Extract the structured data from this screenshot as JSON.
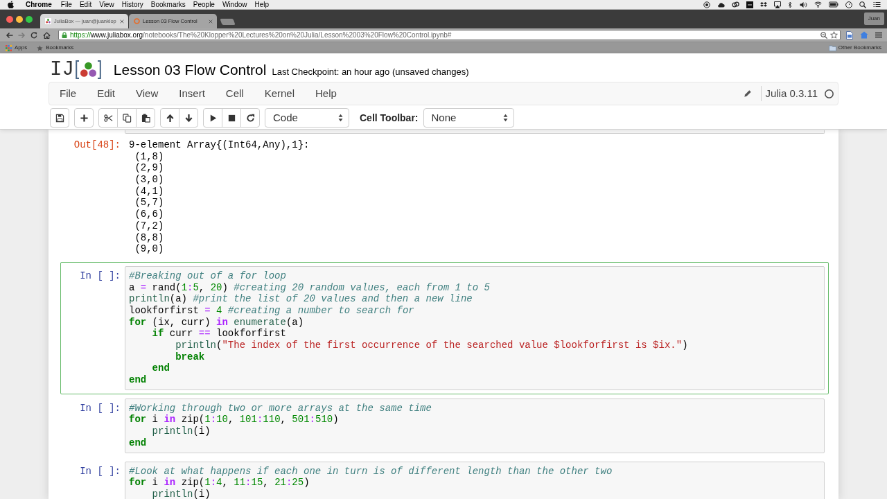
{
  "mac_menu_bar": {
    "app": "Chrome",
    "menus": [
      "File",
      "Edit",
      "View",
      "History",
      "Bookmarks",
      "People",
      "Window",
      "Help"
    ]
  },
  "browser": {
    "tabs": [
      {
        "title": "JuliaBox — juan@juanklop",
        "selected": false
      },
      {
        "title": "Lesson 03 Flow Control",
        "selected": true
      }
    ],
    "profile": "Juan",
    "address": {
      "scheme": "https://",
      "host": "www.juliabox.org",
      "path": "/notebooks/The%20Klopper%20Lectures%20on%20Julia/Lesson%2003%20Flow%20Control.ipynb#"
    },
    "bookmarks": [
      "Apps",
      "Bookmarks"
    ],
    "other_bookmarks": "Other Bookmarks"
  },
  "notebook": {
    "logo": "IJ",
    "title": "Lesson 03 Flow Control",
    "checkpoint": "Last Checkpoint: an hour ago (unsaved changes)",
    "menus": [
      "File",
      "Edit",
      "View",
      "Insert",
      "Cell",
      "Kernel",
      "Help"
    ],
    "kernel": "Julia 0.3.11",
    "cell_type": "Code",
    "cell_toolbar_label": "Cell Toolbar:",
    "cell_toolbar": "None"
  },
  "cells": [
    {
      "kind": "output",
      "prompt": "Out[48]:",
      "selected": false,
      "lines": [
        "9-element Array{(Int64,Any),1}:",
        " (1,8)",
        " (2,9)",
        " (3,0)",
        " (4,1)",
        " (5,7)",
        " (6,6)",
        " (7,2)",
        " (8,8)",
        " (9,0)"
      ]
    },
    {
      "kind": "code",
      "prompt": "In [ ]:",
      "selected": true,
      "lines": [
        [
          {
            "kind": "comment",
            "text": "#Breaking out of a for loop"
          }
        ],
        [
          {
            "kind": "text",
            "text": "a "
          },
          {
            "kind": "operator",
            "text": "="
          },
          {
            "kind": "text",
            "text": " rand("
          },
          {
            "kind": "number",
            "text": "1"
          },
          {
            "kind": "operator",
            "text": ":"
          },
          {
            "kind": "number",
            "text": "5"
          },
          {
            "kind": "text",
            "text": ", "
          },
          {
            "kind": "number",
            "text": "20"
          },
          {
            "kind": "text",
            "text": ") "
          },
          {
            "kind": "comment",
            "text": "#creating 20 random values, each from 1 to 5"
          }
        ],
        [
          {
            "kind": "builtin",
            "text": "println"
          },
          {
            "kind": "text",
            "text": "(a) "
          },
          {
            "kind": "comment",
            "text": "#print the list of 20 values and then a new line"
          }
        ],
        [
          {
            "kind": "text",
            "text": "lookforfirst "
          },
          {
            "kind": "operator",
            "text": "="
          },
          {
            "kind": "number",
            "text": " 4"
          },
          {
            "kind": "comment",
            "text": " #creating a number to search for"
          }
        ],
        [
          {
            "kind": "keyword",
            "text": "for"
          },
          {
            "kind": "text",
            "text": " (ix, curr) "
          },
          {
            "kind": "word_operator",
            "text": "in"
          },
          {
            "kind": "builtin",
            "text": " enumerate"
          },
          {
            "kind": "text",
            "text": "(a)"
          }
        ],
        [
          {
            "kind": "keyword",
            "text": "    if"
          },
          {
            "kind": "text",
            "text": " curr "
          },
          {
            "kind": "operator",
            "text": "=="
          },
          {
            "kind": "text",
            "text": " lookforfirst"
          }
        ],
        [
          {
            "kind": "builtin",
            "text": "        println"
          },
          {
            "kind": "text",
            "text": "("
          },
          {
            "kind": "string",
            "text": "\"The index of the first occurrence of the searched value $lookforfirst is $ix.\""
          },
          {
            "kind": "text",
            "text": ")"
          }
        ],
        [
          {
            "kind": "keyword",
            "text": "        break"
          }
        ],
        [
          {
            "kind": "keyword",
            "text": "    end"
          }
        ],
        [
          {
            "kind": "keyword",
            "text": "end"
          }
        ]
      ]
    },
    {
      "kind": "code",
      "prompt": "In [ ]:",
      "selected": false,
      "lines": [
        [
          {
            "kind": "comment",
            "text": "#Working through two or more arrays at the same time"
          }
        ],
        [
          {
            "kind": "keyword",
            "text": "for"
          },
          {
            "kind": "text",
            "text": " i "
          },
          {
            "kind": "word_operator",
            "text": "in"
          },
          {
            "kind": "text",
            "text": " zip("
          },
          {
            "kind": "number",
            "text": "1"
          },
          {
            "kind": "operator",
            "text": ":"
          },
          {
            "kind": "number",
            "text": "10"
          },
          {
            "kind": "text",
            "text": ", "
          },
          {
            "kind": "number",
            "text": "101"
          },
          {
            "kind": "operator",
            "text": ":"
          },
          {
            "kind": "number",
            "text": "110"
          },
          {
            "kind": "text",
            "text": ", "
          },
          {
            "kind": "number",
            "text": "501"
          },
          {
            "kind": "operator",
            "text": ":"
          },
          {
            "kind": "number",
            "text": "510"
          },
          {
            "kind": "text",
            "text": ")"
          }
        ],
        [
          {
            "kind": "builtin",
            "text": "    println"
          },
          {
            "kind": "text",
            "text": "(i)"
          }
        ],
        [
          {
            "kind": "keyword",
            "text": "end"
          }
        ]
      ]
    },
    {
      "kind": "code",
      "prompt": "In [ ]:",
      "selected": false,
      "lines": [
        [
          {
            "kind": "comment",
            "text": "#Look at what happens if each one in turn is of different length than the other two"
          }
        ],
        [
          {
            "kind": "keyword",
            "text": "for"
          },
          {
            "kind": "text",
            "text": " i "
          },
          {
            "kind": "word_operator",
            "text": "in"
          },
          {
            "kind": "text",
            "text": " zip("
          },
          {
            "kind": "number",
            "text": "1"
          },
          {
            "kind": "operator",
            "text": ":"
          },
          {
            "kind": "number",
            "text": "4"
          },
          {
            "kind": "text",
            "text": ", "
          },
          {
            "kind": "number",
            "text": "11"
          },
          {
            "kind": "operator",
            "text": ":"
          },
          {
            "kind": "number",
            "text": "15"
          },
          {
            "kind": "text",
            "text": ", "
          },
          {
            "kind": "number",
            "text": "21"
          },
          {
            "kind": "operator",
            "text": ":"
          },
          {
            "kind": "number",
            "text": "25"
          },
          {
            "kind": "text",
            "text": ")"
          }
        ],
        [
          {
            "kind": "builtin",
            "text": "    println"
          },
          {
            "kind": "text",
            "text": "(i)"
          }
        ]
      ]
    }
  ]
}
